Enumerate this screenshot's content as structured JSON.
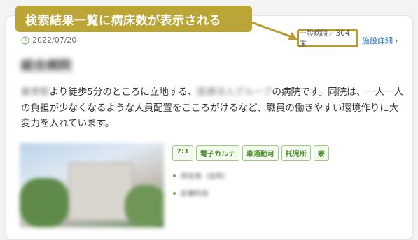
{
  "callout": {
    "text": "検索結果一覧に病床数が表示される"
  },
  "card": {
    "date": "2022/07/20",
    "beds_label": "一般病院／304床",
    "detail_link": "施設詳細",
    "detail_chevron": "›",
    "hospital_name_blurred": "総合病院",
    "description": {
      "part1_blurred": "最寄駅",
      "part2": "より徒歩5分のところに立地する、",
      "part3_blurred": "医療法人グループ",
      "part4": "の病院です。同院は、一人一人の負担が少なくなるような人員配置をこころがけるなど、職員の働きやすい環境作りに大変力を入れています。"
    },
    "tags": [
      "7:1",
      "電子カルテ",
      "車通勤可",
      "託児所",
      "寮"
    ],
    "info_lines_blurred": [
      "所在地（住所）",
      "診療科目"
    ]
  },
  "colors": {
    "callout_bg": "#bba536",
    "highlight_border": "#b99a2e",
    "tag_green": "#4a8a2c",
    "link_blue": "#2a78c7"
  }
}
